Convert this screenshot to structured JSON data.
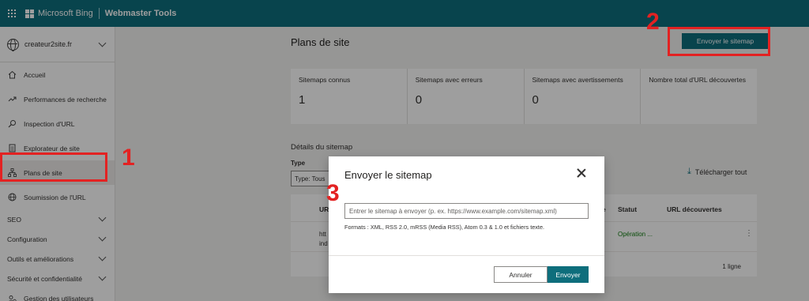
{
  "topbar": {
    "brand": "Microsoft Bing",
    "product": "Webmaster Tools"
  },
  "sidebar": {
    "site": "createur2site.fr",
    "items": [
      {
        "label": "Accueil",
        "icon": "home-icon"
      },
      {
        "label": "Performances de recherche",
        "icon": "trend-icon"
      },
      {
        "label": "Inspection d'URL",
        "icon": "search-icon"
      },
      {
        "label": "Explorateur de site",
        "icon": "document-icon"
      },
      {
        "label": "Plans de site",
        "icon": "sitemap-icon"
      },
      {
        "label": "Soumission de l'URL",
        "icon": "globe-icon"
      }
    ],
    "sections": [
      "SEO",
      "Configuration",
      "Outils et améliorations",
      "Sécurité et confidentialité"
    ],
    "bottom_item": {
      "label": "Gestion des utilisateurs",
      "icon": "users-icon"
    }
  },
  "main": {
    "title": "Plans de site",
    "submit_button": "Envoyer le sitemap",
    "stats": [
      {
        "label": "Sitemaps connus",
        "value": "1"
      },
      {
        "label": "Sitemaps avec erreurs",
        "value": "0"
      },
      {
        "label": "Sitemaps avec avertissements",
        "value": "0"
      },
      {
        "label": "Nombre total d'URL découvertes",
        "value": ""
      }
    ],
    "details_title": "Détails du sitemap",
    "type_label": "Type",
    "type_value": "Type: Tous",
    "download": "Télécharger tout",
    "table": {
      "col_url": "URL",
      "col_type": "e",
      "col_status": "Statut",
      "col_urls": "URL découvertes",
      "row_url_1": "htt",
      "row_url_2": "ind",
      "row_status": "Opération ...",
      "count": "1 ligne"
    }
  },
  "dialog": {
    "title": "Envoyer le sitemap",
    "input_placeholder": "Entrer le sitemap à envoyer (p. ex. https://www.example.com/sitemap.xml)",
    "hint": "Formats : XML, RSS 2.0, mRSS (Media RSS), Atom 0.3 & 1.0 et fichiers texte.",
    "cancel": "Annuler",
    "send": "Envoyer"
  },
  "annotations": {
    "n1": "1",
    "n2": "2",
    "n3": "3",
    "color": "#e32222"
  },
  "colors": {
    "accent": "#0e6e7c",
    "success": "#107c10"
  }
}
